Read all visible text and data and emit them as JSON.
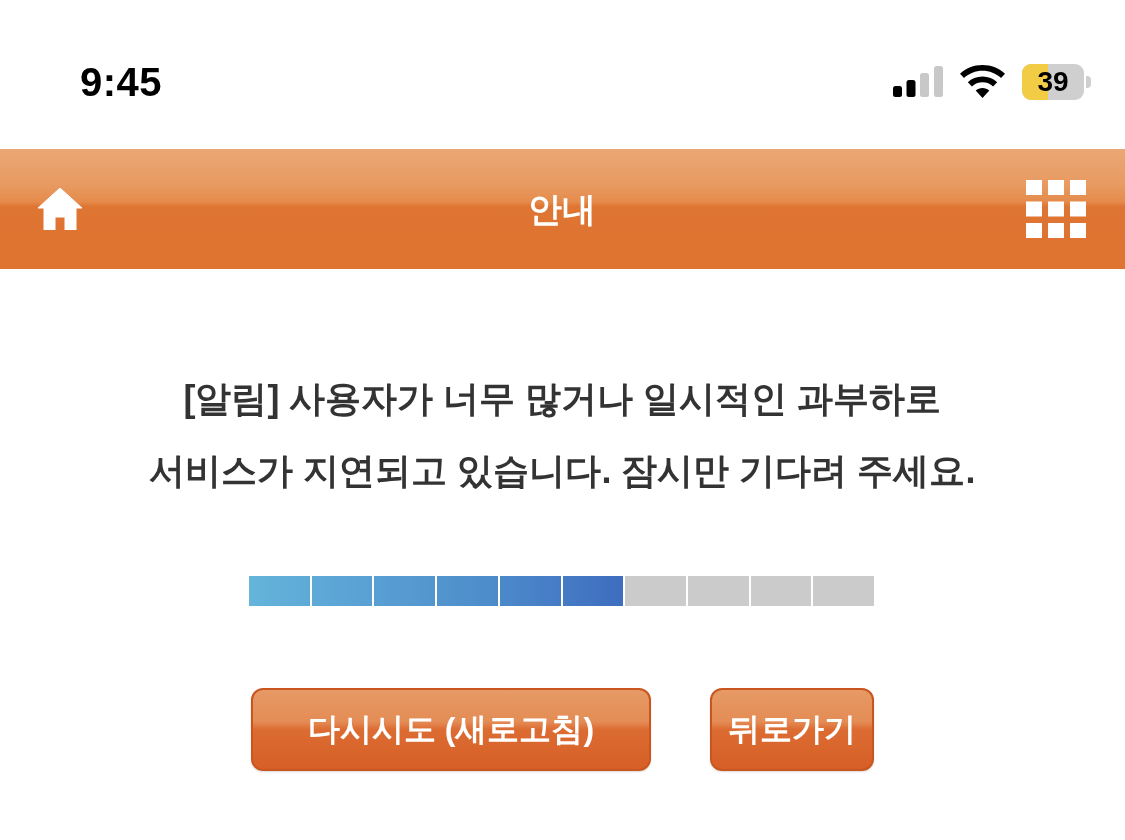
{
  "status_bar": {
    "time": "9:45",
    "battery": "39"
  },
  "header": {
    "title": "안내"
  },
  "notice": {
    "text": "[알림] 사용자가 너무 많거나 일시적인 과부하로\n서비스가 지연되고 있습니다. 잠시만 기다려 주세요."
  },
  "progress": {
    "level": 0.6
  },
  "buttons": [
    "다시시도 (새로고침)",
    "뒤로가기"
  ]
}
